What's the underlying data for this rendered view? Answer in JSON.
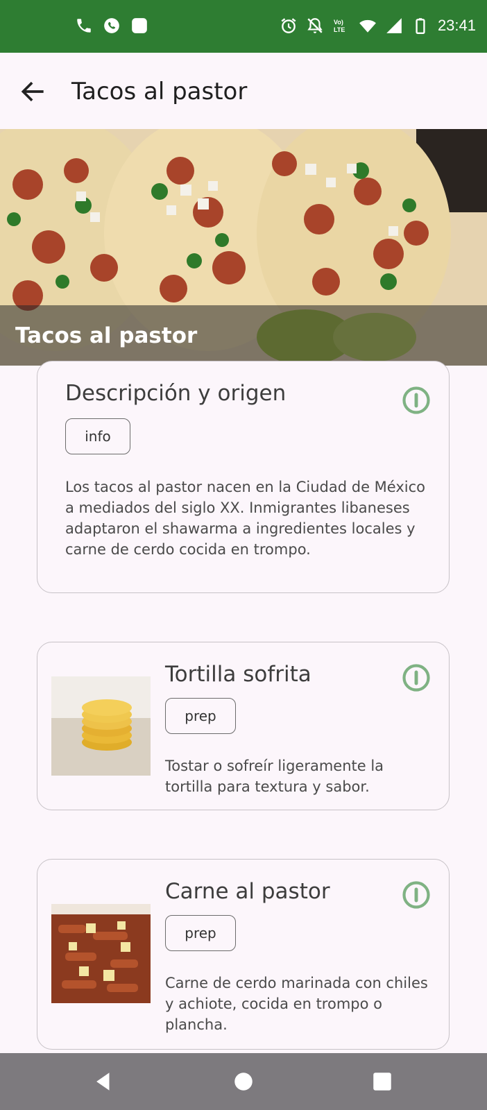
{
  "status_bar": {
    "time": "23:41",
    "left_icons": [
      "phone-icon",
      "whatsapp-icon",
      "app-square-icon"
    ],
    "right_icons": [
      "alarm-icon",
      "notifications-off-icon",
      "volte-icon",
      "wifi-icon",
      "signal-icon",
      "battery-icon"
    ],
    "volte_label": "Vo) LTE",
    "color": "#2e7d32"
  },
  "app_bar": {
    "title": "Tacos al pastor",
    "back_icon": "arrow-back-icon"
  },
  "hero": {
    "title": "Tacos al pastor"
  },
  "cards": [
    {
      "title": "Descripción y origen",
      "tag": "info",
      "description": "Los tacos al pastor nacen en la Ciudad de México a mediados del siglo XX. Inmigrantes libaneses adaptaron el shawarma a ingredientes locales y carne de cerdo cocida en trompo.",
      "icon": "info-icon"
    },
    {
      "title": "Tortilla sofrita",
      "tag": "prep",
      "description": "Tostar o sofreír ligeramente la tortilla para textura y sabor.",
      "icon": "info-icon"
    },
    {
      "title": "Carne al pastor",
      "tag": "prep",
      "description": "Carne de cerdo marinada con chiles y achiote, cocida en trompo o plancha.",
      "icon": "info-icon"
    }
  ],
  "nav_bar": {
    "icons": [
      "nav-back-icon",
      "nav-home-icon",
      "nav-recents-icon"
    ]
  },
  "colors": {
    "accent": "#2e7d32",
    "info_icon": "#7fb283",
    "background": "#fcf6fb",
    "nav_bar": "#7d7a7e"
  }
}
